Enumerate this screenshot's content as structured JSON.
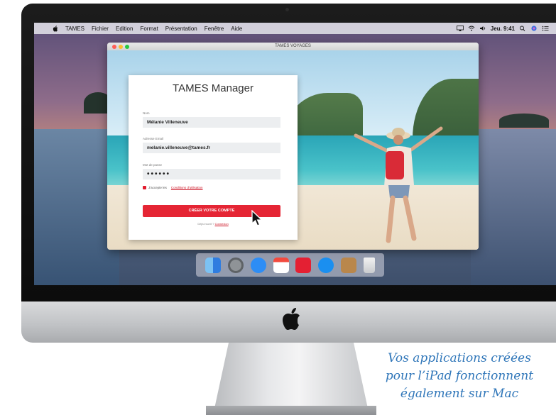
{
  "menubar": {
    "items": [
      "TAMES",
      "Fichier",
      "Edition",
      "Format",
      "Présentation",
      "Fenêtre",
      "Aide"
    ],
    "clock": "Jeu. 9:41"
  },
  "window": {
    "title": "TAMES VOYAGES"
  },
  "form": {
    "title": "TAMES Manager",
    "name_label": "Nom",
    "name_value": "Mélanie Villeneuve",
    "email_label": "Adresse Email",
    "email_value": "melanie.villeneuve@tames.fr",
    "password_label": "Mot de passe",
    "password_value": "••••••",
    "terms_text": "J'accepte les",
    "terms_link": "Conditions d'utilisation",
    "submit_label": "CRÉER VOTRE COMPTE",
    "login_text": "Déjà inscrit ?",
    "login_link": "Connexion",
    "accent_color": "#e52534"
  },
  "dock": {
    "items": [
      "finder-icon",
      "system-preferences-icon",
      "messages-icon",
      "calendar-icon",
      "tames-app-icon",
      "app-store-icon",
      "archive-icon",
      "trash-icon"
    ]
  },
  "caption": {
    "line1": "Vos applications créées",
    "line2": "pour l’iPad fonctionnent",
    "line3": "également sur Mac"
  }
}
